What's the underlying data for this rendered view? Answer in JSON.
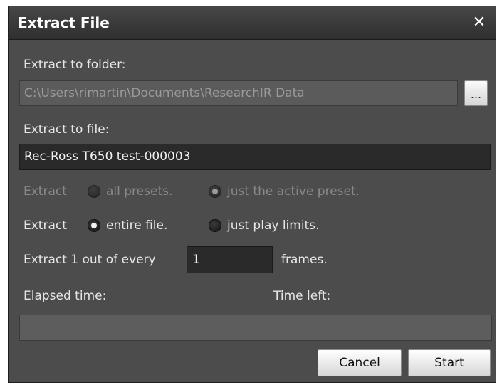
{
  "dialog": {
    "title": "Extract File",
    "close_glyph": "✕"
  },
  "folder": {
    "label": "Extract to folder:",
    "value": "C:\\Users\\rimartin\\Documents\\ResearchIR Data",
    "browse_label": "..."
  },
  "file": {
    "label": "Extract to file:",
    "value": "Rec-Ross T650 test-000003"
  },
  "presets": {
    "label": "Extract",
    "options": [
      {
        "label": "all presets.",
        "selected": false,
        "enabled": false
      },
      {
        "label": "just the active preset.",
        "selected": true,
        "enabled": false
      }
    ]
  },
  "range": {
    "label": "Extract",
    "options": [
      {
        "label": "entire file.",
        "selected": true,
        "enabled": true
      },
      {
        "label": "just play limits.",
        "selected": false,
        "enabled": true
      }
    ]
  },
  "frames": {
    "prefix": "Extract 1 out of every",
    "value": "1",
    "suffix": "frames."
  },
  "elapsed": {
    "label": "Elapsed time:"
  },
  "remaining": {
    "label": "Time left:"
  },
  "progress": {
    "fraction": 0
  },
  "buttons": {
    "cancel": "Cancel",
    "start": "Start"
  }
}
